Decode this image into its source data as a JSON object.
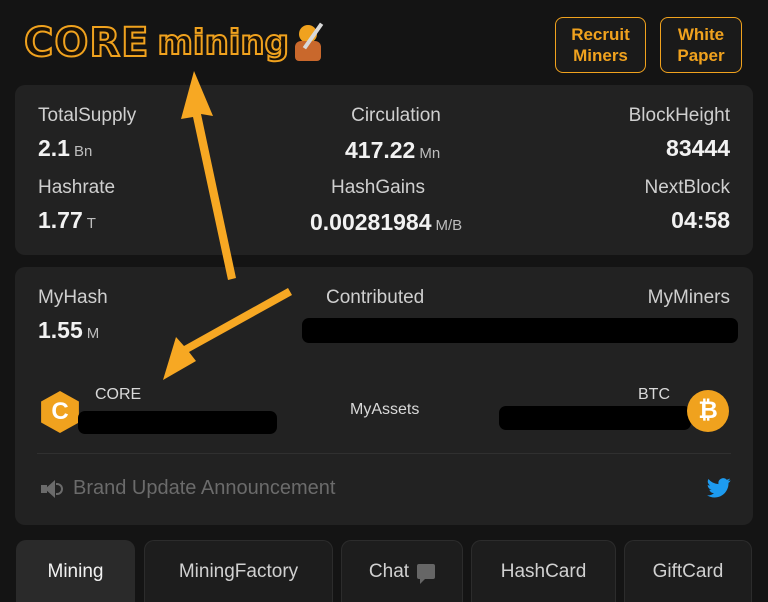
{
  "header": {
    "logo_word1": "CORE",
    "logo_word2": "mining",
    "recruit_label": "Recruit\nMiners",
    "whitepaper_label": "White\nPaper"
  },
  "stats": {
    "total_supply": {
      "label": "TotalSupply",
      "value": "2.1",
      "unit": "Bn"
    },
    "circulation": {
      "label": "Circulation",
      "value": "417.22",
      "unit": "Mn"
    },
    "block_height": {
      "label": "BlockHeight",
      "value": "83444"
    },
    "hashrate": {
      "label": "Hashrate",
      "value": "1.77",
      "unit": "T"
    },
    "hash_gains": {
      "label": "HashGains",
      "value": "0.00281984",
      "unit": "M/B"
    },
    "next_block": {
      "label": "NextBlock",
      "value": "04:58"
    }
  },
  "my": {
    "myhash": {
      "label": "MyHash",
      "value": "1.55",
      "unit": "M"
    },
    "contributed_label": "Contributed",
    "myminers_label": "MyMiners",
    "core_label": "CORE",
    "assets_label": "MyAssets",
    "btc_label": "BTC",
    "core_coin_glyph": "C",
    "btc_coin_glyph": "₿",
    "announcement": "Brand Update Announcement"
  },
  "tabs": [
    {
      "label": "Mining",
      "active": true
    },
    {
      "label": "MiningFactory"
    },
    {
      "label": "Chat"
    },
    {
      "label": "HashCard"
    },
    {
      "label": "GiftCard"
    }
  ],
  "colors": {
    "accent": "#f0a21e",
    "background": "#141414",
    "card": "#222222",
    "twitter": "#1d9bf0"
  },
  "icons": [
    "speaker-icon",
    "twitter-icon",
    "chat-icon",
    "core-coin-icon",
    "bitcoin-icon",
    "arrow-annotation"
  ]
}
